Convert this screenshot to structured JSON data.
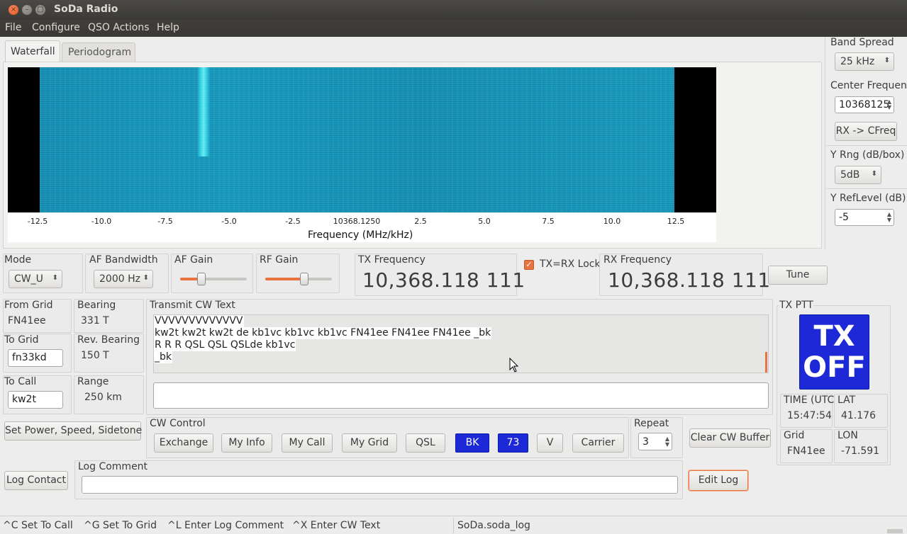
{
  "window": {
    "title": "SoDa Radio"
  },
  "menu": [
    "File",
    "Configure",
    "QSO Actions",
    "Help"
  ],
  "tabs": {
    "waterfall": "Waterfall",
    "periodogram": "Periodogram"
  },
  "waterfall": {
    "ticks": [
      "-12.5",
      "-10.0",
      "-7.5",
      "-5.0",
      "-2.5",
      "10368.1250",
      "2.5",
      "5.0",
      "7.5",
      "10.0",
      "12.5"
    ],
    "xlabel": "Frequency (MHz/kHz)"
  },
  "right_panel": {
    "band_spread_label": "Band Spread",
    "band_spread_value": "25 kHz",
    "center_freq_label": "Center Frequenc",
    "center_freq_value": "10368125",
    "rx_cfreq_button": "RX -> CFreq",
    "y_rng_label": "Y Rng (dB/box)",
    "y_rng_value": "5dB",
    "y_ref_label": "Y RefLevel (dB)",
    "y_ref_value": "-5"
  },
  "controls": {
    "mode_label": "Mode",
    "mode_value": "CW_U",
    "af_bw_label": "AF Bandwidth",
    "af_bw_value": "2000 Hz",
    "af_gain_label": "AF Gain",
    "af_gain_level": 0.32,
    "rf_gain_label": "RF Gain",
    "rf_gain_level": 0.59,
    "tx_freq_label": "TX Frequency",
    "tx_freq_value": "10,368.118 111",
    "tx_rx_lock_label": "TX=RX Lock",
    "rx_freq_label": "RX Frequency",
    "rx_freq_value": "10,368.118 111",
    "tune_button": "Tune"
  },
  "grid_info": {
    "from_grid_label": "From Grid",
    "from_grid_value": "FN41ee",
    "bearing_label": "Bearing",
    "bearing_value": "331 T",
    "to_grid_label": "To Grid",
    "to_grid_value": "fn33kd",
    "rev_bearing_label": "Rev. Bearing",
    "rev_bearing_value": "150 T",
    "to_call_label": "To Call",
    "to_call_value": "kw2t",
    "range_label": "Range",
    "range_value": "250 km"
  },
  "transmit": {
    "label": "Transmit CW Text",
    "lines": [
      "VVVVVVVVVVVVV",
      "kw2t kw2t kw2t  de kb1vc kb1vc kb1vc  FN41ee FN41ee FN41ee  _bk",
      "R R R  QSL QSL QSLde kb1vc",
      "_bk"
    ],
    "input_value": ""
  },
  "tx_ptt": {
    "label": "TX PTT",
    "button_line1": "TX",
    "button_line2": "OFF",
    "time_label": "TIME (UTC",
    "time_value": "15:47:54",
    "lat_label": "LAT",
    "lat_value": "41.176",
    "grid_label": "Grid",
    "grid_value": "FN41ee",
    "lon_label": "LON",
    "lon_value": "-71.591"
  },
  "cw_control": {
    "set_power_button": "Set Power, Speed, Sidetone",
    "label": "CW Control",
    "buttons": [
      "Exchange",
      "My Info",
      "My Call",
      "My Grid",
      "QSL",
      "BK",
      "73",
      "V",
      "Carrier"
    ],
    "repeat_label": "Repeat",
    "repeat_value": "3",
    "clear_button": "Clear CW Buffer"
  },
  "log": {
    "log_contact_button": "Log Contact",
    "comment_label": "Log Comment",
    "comment_value": "",
    "edit_log_button": "Edit Log"
  },
  "status": {
    "hints": [
      "^C Set To Call",
      "^G Set To Grid",
      "^L Enter Log Comment",
      "^X Enter CW Text"
    ],
    "logfile": "SoDa.soda_log"
  },
  "colors": {
    "accent": "#e8733f",
    "tx_button": "#1d28d6",
    "waterfall": "#1a9dc0"
  }
}
